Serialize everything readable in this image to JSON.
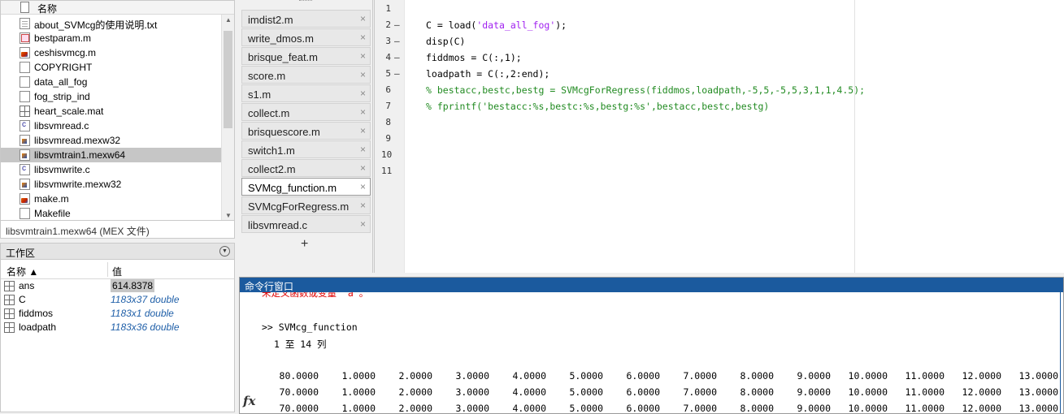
{
  "file_browser": {
    "header_label": "名称",
    "files": [
      {
        "name": "about_SVMcg的使用说明.txt",
        "icon": "text-file-icon",
        "selected": false
      },
      {
        "name": "bestparam.m",
        "icon": "figure-file-icon",
        "selected": false
      },
      {
        "name": "ceshisvmcg.m",
        "icon": "matlab-script-icon",
        "selected": false
      },
      {
        "name": "COPYRIGHT",
        "icon": "plain-file-icon",
        "selected": false
      },
      {
        "name": "data_all_fog",
        "icon": "plain-file-icon",
        "selected": false
      },
      {
        "name": "fog_strip_ind",
        "icon": "plain-file-icon",
        "selected": false
      },
      {
        "name": "heart_scale.mat",
        "icon": "mat-file-icon",
        "selected": false
      },
      {
        "name": "libsvmread.c",
        "icon": "c-file-icon",
        "selected": false
      },
      {
        "name": "libsvmread.mexw32",
        "icon": "mex-file-icon",
        "selected": false
      },
      {
        "name": "libsvmtrain1.mexw64",
        "icon": "mex-file-icon",
        "selected": true
      },
      {
        "name": "libsvmwrite.c",
        "icon": "c-file-icon",
        "selected": false
      },
      {
        "name": "libsvmwrite.mexw32",
        "icon": "mex-file-icon",
        "selected": false
      },
      {
        "name": "make.m",
        "icon": "matlab-script-icon",
        "selected": false
      },
      {
        "name": "Makefile",
        "icon": "plain-file-icon",
        "selected": false
      }
    ],
    "details": "libsvmtrain1.mexw64  (MEX 文件)"
  },
  "workspace": {
    "title": "工作区",
    "col_name": "名称 ▲",
    "col_value": "值",
    "variables": [
      {
        "name": "ans",
        "value": "614.8378"
      },
      {
        "name": "C",
        "value": "1183x37 double"
      },
      {
        "name": "fiddmos",
        "value": "1183x1 double"
      },
      {
        "name": "loadpath",
        "value": "1183x36 double"
      }
    ]
  },
  "editor_tabs": {
    "tabs": [
      {
        "label": "imdist2.m",
        "active": false
      },
      {
        "label": "write_dmos.m",
        "active": false
      },
      {
        "label": "brisque_feat.m",
        "active": false
      },
      {
        "label": "score.m",
        "active": false
      },
      {
        "label": "s1.m",
        "active": false
      },
      {
        "label": "collect.m",
        "active": false
      },
      {
        "label": "brisquescore.m",
        "active": false
      },
      {
        "label": "switch1.m",
        "active": false
      },
      {
        "label": "collect2.m",
        "active": false
      },
      {
        "label": "SVMcg_function.m",
        "active": true
      },
      {
        "label": "SVMcgForRegress.m",
        "active": false
      },
      {
        "label": "libsvmread.c",
        "active": false
      }
    ],
    "close_glyph": "×",
    "add_glyph": "+"
  },
  "code_editor": {
    "lines": [
      {
        "num": "1",
        "dash": "",
        "parts": []
      },
      {
        "num": "2",
        "dash": "–",
        "parts": [
          {
            "t": "C = load(",
            "c": ""
          },
          {
            "t": "'data_all_fog'",
            "c": "str"
          },
          {
            "t": ");",
            "c": ""
          }
        ]
      },
      {
        "num": "3",
        "dash": "–",
        "parts": [
          {
            "t": "disp(C)",
            "c": ""
          }
        ]
      },
      {
        "num": "4",
        "dash": "–",
        "parts": [
          {
            "t": "fiddmos = C(:,1);",
            "c": ""
          }
        ]
      },
      {
        "num": "5",
        "dash": "–",
        "parts": [
          {
            "t": "loadpath = C(:,2:end);",
            "c": ""
          }
        ]
      },
      {
        "num": "6",
        "dash": "",
        "parts": [
          {
            "t": "% bestacc,bestc,bestg = SVMcgForRegress(fiddmos,loadpath,-5,5,-5,5,3,1,1,4.5);",
            "c": "cmt"
          }
        ]
      },
      {
        "num": "7",
        "dash": "",
        "parts": [
          {
            "t": "% fprintf('bestacc:%s,bestc:%s,bestg:%s',bestacc,bestc,bestg)",
            "c": "cmt"
          }
        ]
      },
      {
        "num": "8",
        "dash": "",
        "parts": []
      },
      {
        "num": "9",
        "dash": "",
        "parts": []
      },
      {
        "num": "10",
        "dash": "",
        "parts": []
      },
      {
        "num": "11",
        "dash": "",
        "parts": []
      }
    ]
  },
  "command_window": {
    "title": "命令行窗口",
    "error_line": "未定义函数或变量 'a'。",
    "prompt_line": ">> SVMcg_function",
    "columns_label": "1 至 14 列",
    "rows": [
      [
        "80.0000",
        "1.0000",
        "2.0000",
        "3.0000",
        "4.0000",
        "5.0000",
        "6.0000",
        "7.0000",
        "8.0000",
        "9.0000",
        "10.0000",
        "11.0000",
        "12.0000",
        "13.0000"
      ],
      [
        "70.0000",
        "1.0000",
        "2.0000",
        "3.0000",
        "4.0000",
        "5.0000",
        "6.0000",
        "7.0000",
        "8.0000",
        "9.0000",
        "10.0000",
        "11.0000",
        "12.0000",
        "13.0000"
      ],
      [
        "70.0000",
        "1.0000",
        "2.0000",
        "3.0000",
        "4.0000",
        "5.0000",
        "6.0000",
        "7.0000",
        "8.0000",
        "9.0000",
        "10.0000",
        "11.0000",
        "12.0000",
        "13.0000"
      ]
    ],
    "fx_label": "fx"
  }
}
